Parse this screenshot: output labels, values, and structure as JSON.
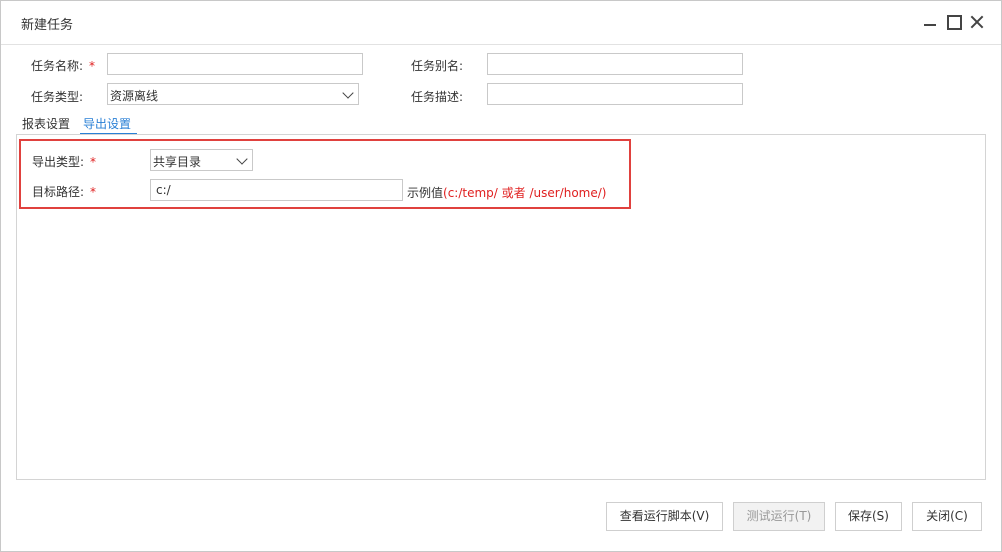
{
  "window": {
    "title": "新建任务"
  },
  "form": {
    "task_name": {
      "label": "任务名称:",
      "required_mark": "*",
      "value": ""
    },
    "task_alias": {
      "label": "任务别名:",
      "value": ""
    },
    "task_type": {
      "label": "任务类型:",
      "value": "资源离线"
    },
    "task_desc": {
      "label": "任务描述:",
      "value": ""
    }
  },
  "tabs": [
    {
      "label": "报表设置",
      "active": false
    },
    {
      "label": "导出设置",
      "active": true
    }
  ],
  "export": {
    "type": {
      "label": "导出类型:",
      "required_mark": "*",
      "value": "共享目录"
    },
    "path": {
      "label": "目标路径:",
      "required_mark": "*",
      "value": "c:/"
    },
    "example_prefix": "示例值",
    "example_value": "(c:/temp/ 或者 /user/home/)"
  },
  "buttons": {
    "view_script": "查看运行脚本(V)",
    "test_run": "测试运行(T)",
    "save": "保存(S)",
    "close": "关闭(C)"
  },
  "colors": {
    "accent": "#2a80d6",
    "required": "#e02020",
    "highlight_border": "#e0413e"
  }
}
